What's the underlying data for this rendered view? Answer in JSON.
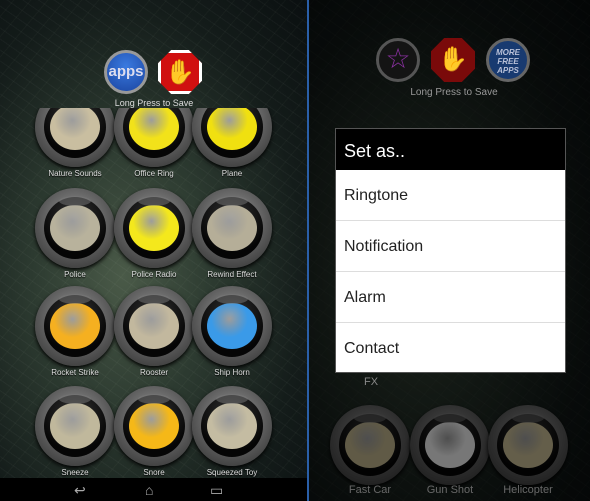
{
  "left": {
    "top_buttons": [
      {
        "label": "apps",
        "icon": "apps-icon"
      },
      {
        "icon": "stop-hand-icon"
      }
    ],
    "save_hint": "Long Press to Save",
    "sounds": [
      {
        "label": "Nature Sounds",
        "color": "#c9bea0"
      },
      {
        "label": "Office Ring",
        "color": "#f2e21a"
      },
      {
        "label": "Plane",
        "color": "#f0e010"
      },
      {
        "label": "Police",
        "color": "#b8b29c"
      },
      {
        "label": "Police Radio",
        "color": "#f4e81c"
      },
      {
        "label": "Rewind Effect",
        "color": "#b5ae98"
      },
      {
        "label": "Rocket Strike",
        "color": "#f5b020"
      },
      {
        "label": "Rooster",
        "color": "#c2b89e"
      },
      {
        "label": "Ship Horn",
        "color": "#3a9ae8"
      },
      {
        "label": "Sneeze",
        "color": "#c0b89c"
      },
      {
        "label": "Snore",
        "color": "#f5b818"
      },
      {
        "label": "Squeezed Toy",
        "color": "#c4bca2"
      }
    ],
    "nav": {
      "back": "↩",
      "home": "⌂",
      "recents": "▭"
    }
  },
  "right": {
    "top_buttons": [
      {
        "icon": "star-icon"
      },
      {
        "icon": "stop-hand-icon"
      },
      {
        "label": "MORE FREE APPS",
        "icon": "more-apps-icon"
      }
    ],
    "save_hint": "Long Press to Save",
    "partial_label": "FX",
    "sounds": [
      {
        "label": "Fast Car",
        "color": "#c0b48c"
      },
      {
        "label": "Gun Shot",
        "color": "#eeeeee"
      },
      {
        "label": "Helicopter",
        "color": "#c8bc94"
      }
    ],
    "dialog": {
      "title": "Set as..",
      "items": [
        "Ringtone",
        "Notification",
        "Alarm",
        "Contact"
      ]
    }
  },
  "colors": {
    "separator": "#2a5fa8",
    "apps_blue": "#1f56b8",
    "stop_red": "#d01010"
  }
}
